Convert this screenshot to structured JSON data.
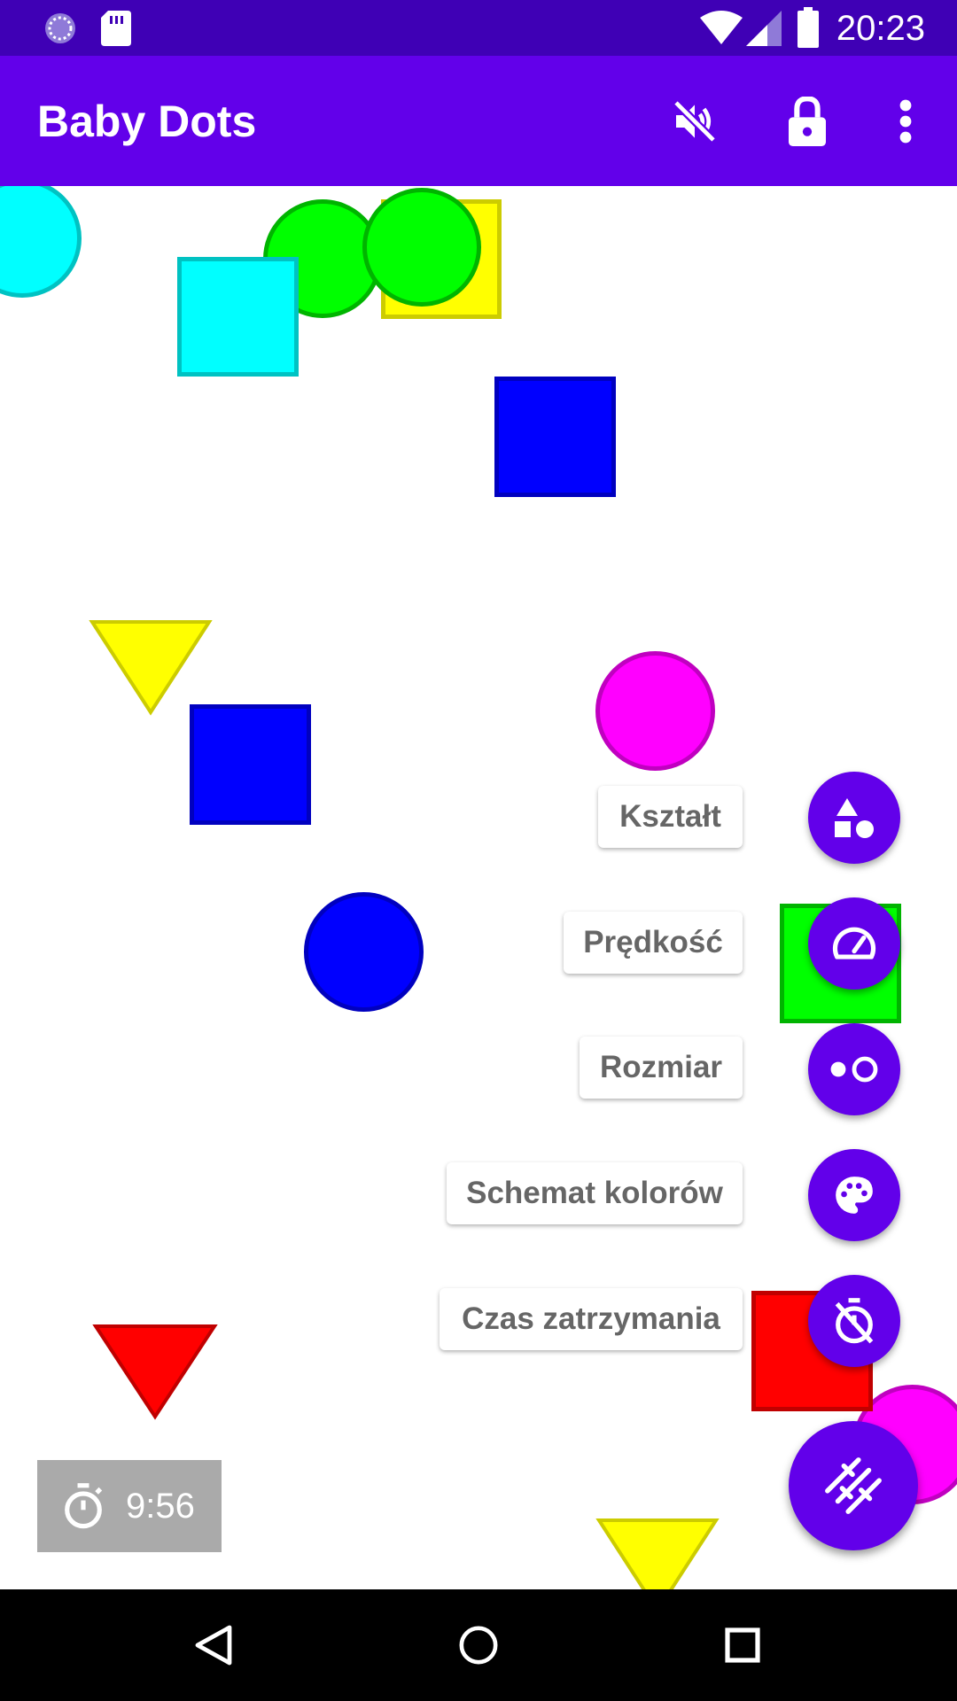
{
  "status_bar": {
    "time": "20:23",
    "icons": [
      "sync-icon",
      "sd-card-icon",
      "wifi-icon",
      "cell-signal-icon",
      "battery-icon"
    ]
  },
  "app_bar": {
    "title": "Baby Dots",
    "actions": [
      "mute-icon",
      "lock-icon",
      "more-vert-icon"
    ],
    "color": "#6200ea"
  },
  "fab_menu": {
    "items": [
      {
        "label": "Kształt",
        "icon": "shapes-icon"
      },
      {
        "label": "Prędkość",
        "icon": "speedometer-icon"
      },
      {
        "label": "Rozmiar",
        "icon": "size-icon"
      },
      {
        "label": "Schemat kolorów",
        "icon": "palette-icon"
      },
      {
        "label": "Czas zatrzymania",
        "icon": "timer-off-icon"
      }
    ],
    "main_icon": "tune-icon"
  },
  "timer": {
    "value": "9:56",
    "icon": "timer-icon"
  },
  "colors": {
    "cyan": "#00ffff",
    "green": "#00ff00",
    "yellow": "#ffff00",
    "blue": "#0000ff",
    "magenta": "#ff00ff",
    "red": "#ff0000"
  },
  "nav_bar": {
    "buttons": [
      "back-icon",
      "home-icon",
      "recents-icon"
    ]
  }
}
